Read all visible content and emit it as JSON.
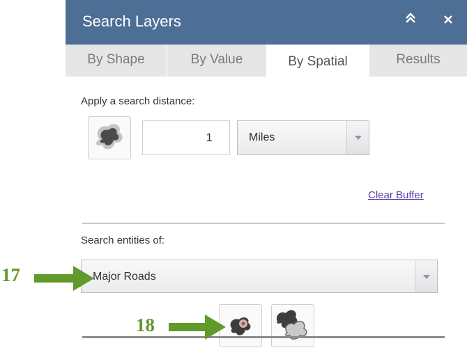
{
  "header": {
    "title": "Search Layers",
    "collapse_icon": "double-chevron-up-icon",
    "close_icon": "close-icon"
  },
  "tabs": [
    {
      "label": "By Shape",
      "active": false
    },
    {
      "label": "By Value",
      "active": false
    },
    {
      "label": "By Spatial",
      "active": true
    },
    {
      "label": "Results",
      "active": false
    }
  ],
  "buffer": {
    "label": "Apply a search distance:",
    "distance_value": "1",
    "unit": "Miles",
    "clear_link": "Clear Buffer",
    "icon": "buffer-shape-icon"
  },
  "entities": {
    "label": "Search entities of:",
    "selected": "Major Roads"
  },
  "spatial_buttons": [
    {
      "icon": "buffer-entity-icon"
    },
    {
      "icon": "overlap-shapes-icon"
    }
  ],
  "annotations": [
    {
      "number": "17"
    },
    {
      "number": "18"
    }
  ],
  "colors": {
    "header_bg": "#4e6f95",
    "tab_bg": "#e6e6e6",
    "link": "#5a3ea6",
    "arrow_green": "#5f9a2b",
    "select_arrow": "#7f98b5"
  }
}
